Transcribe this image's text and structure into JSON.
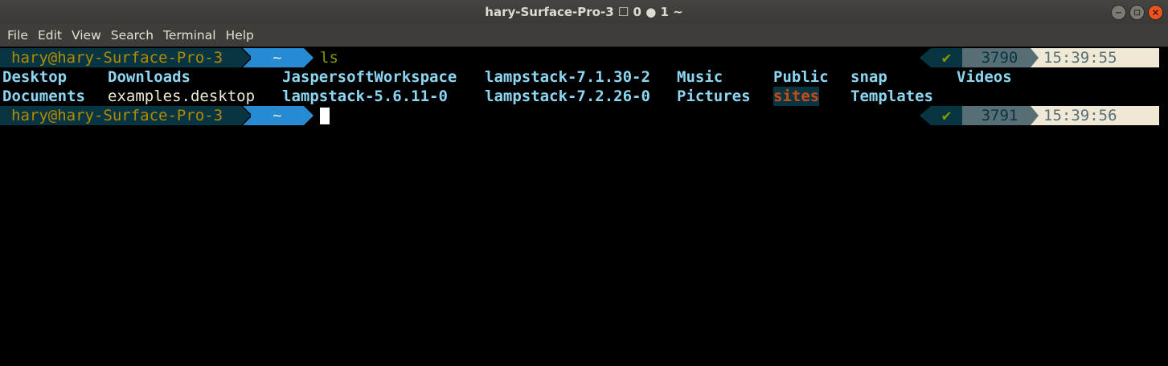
{
  "window": {
    "title": "hary-Surface-Pro-3 ☐ 0 ● 1 ~"
  },
  "menu": [
    "File",
    "Edit",
    "View",
    "Search",
    "Terminal",
    "Help"
  ],
  "colors": {
    "prompt_user_bg": "#073642",
    "prompt_user_fg": "#b58900",
    "prompt_dir_bg": "#268bd2",
    "command_fg": "#859900",
    "directory_fg": "#8dd6f2",
    "special_fg": "#cb4b16",
    "time_bg": "#eee8d5"
  },
  "prompt1": {
    "user": "hary@hary-Surface-Pro-3",
    "dir": "~",
    "command": "ls",
    "status_icon": "✔",
    "history_number": "3790",
    "time": "15:39:55"
  },
  "listing": {
    "row1": [
      "Desktop",
      "Downloads",
      "JaspersoftWorkspace",
      "lampstack-7.1.30-2",
      "Music",
      "Public",
      "snap",
      "Videos"
    ],
    "row2": [
      "Documents",
      "examples.desktop",
      "lampstack-5.6.11-0",
      "lampstack-7.2.26-0",
      "Pictures",
      "sites",
      "Templates"
    ]
  },
  "prompt2": {
    "user": "hary@hary-Surface-Pro-3",
    "dir": "~",
    "status_icon": "✔",
    "history_number": "3791",
    "time": "15:39:56"
  },
  "icons": {
    "minimize": "minimize-icon",
    "maximize": "maximize-icon",
    "close": "close-icon",
    "check": "check-icon"
  }
}
